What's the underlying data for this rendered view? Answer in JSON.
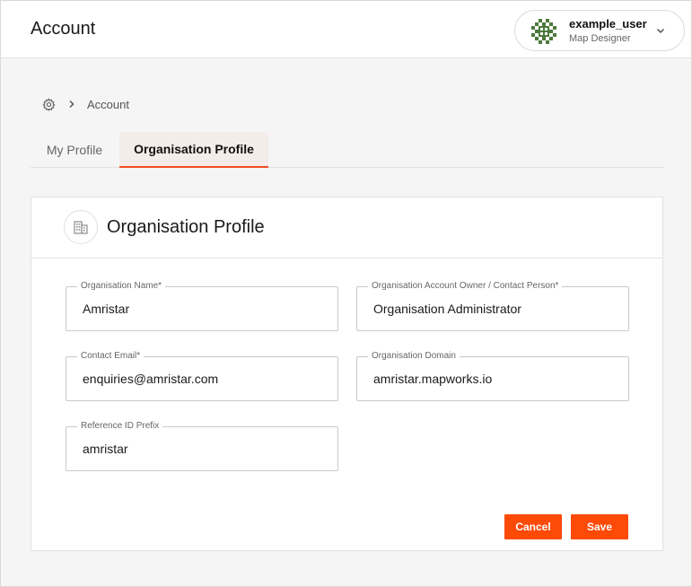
{
  "header": {
    "title": "Account",
    "user": {
      "name": "example_user",
      "role": "Map Designer",
      "avatar_icon": "pixel-pattern-avatar",
      "avatar_color": "#4d7a3d"
    },
    "menu_icon": "chevron-down-icon"
  },
  "breadcrumb": {
    "root_icon": "gear-icon",
    "separator_icon": "chevron-right-icon",
    "current": "Account"
  },
  "tabs": [
    {
      "label": "My Profile",
      "active": false
    },
    {
      "label": "Organisation Profile",
      "active": true
    }
  ],
  "card": {
    "icon": "building-icon",
    "title": "Organisation Profile",
    "fields": {
      "org_name": {
        "label": "Organisation Name*",
        "value": "Amristar"
      },
      "owner": {
        "label": "Organisation Account Owner / Contact Person*",
        "value": "Organisation Administrator"
      },
      "email": {
        "label": "Contact Email*",
        "value": "enquiries@amristar.com"
      },
      "domain": {
        "label": "Organisation Domain",
        "value": "amristar.mapworks.io"
      },
      "ref_prefix": {
        "label": "Reference ID Prefix",
        "value": "amristar"
      }
    },
    "buttons": {
      "cancel": "Cancel",
      "save": "Save"
    }
  },
  "colors": {
    "accent": "#fe4a07",
    "active_tab_bg": "#f4ece9"
  }
}
